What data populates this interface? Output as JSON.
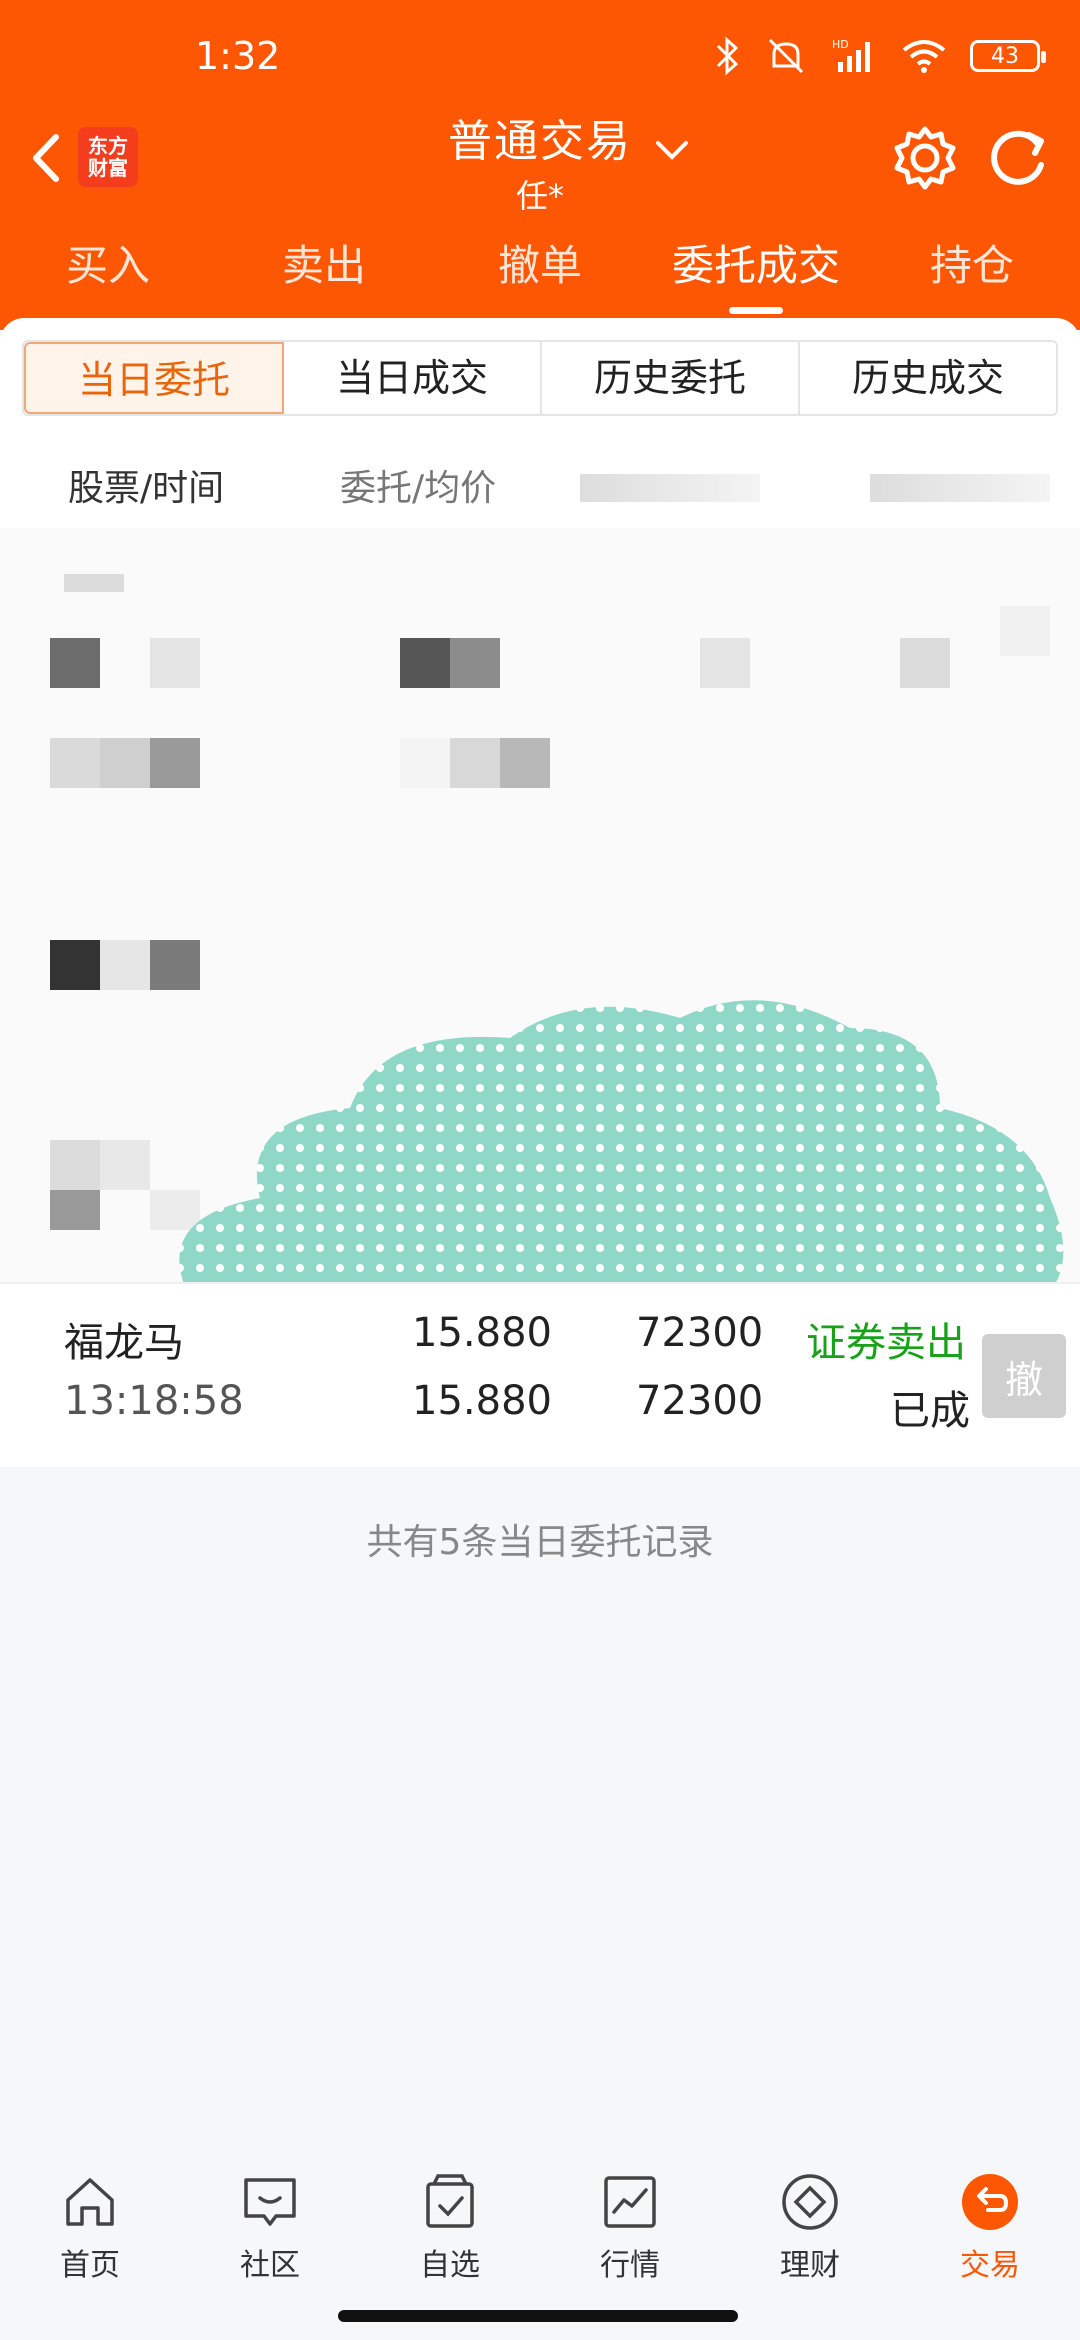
{
  "status_bar": {
    "time": "1:32",
    "battery": "43",
    "network": "HD"
  },
  "header": {
    "logo_text": "东方\n财富",
    "title": "普通交易",
    "subtitle": "任*",
    "tabs": [
      {
        "label": "买入",
        "active": false
      },
      {
        "label": "卖出",
        "active": false
      },
      {
        "label": "撤单",
        "active": false
      },
      {
        "label": "委托成交",
        "active": true
      },
      {
        "label": "持仓",
        "active": false
      }
    ]
  },
  "segment": {
    "items": [
      {
        "label": "当日委托",
        "active": true
      },
      {
        "label": "当日成交",
        "active": false
      },
      {
        "label": "历史委托",
        "active": false
      },
      {
        "label": "历史成交",
        "active": false
      }
    ]
  },
  "columns": {
    "stock_time": "股票/时间",
    "price": "委托/均价"
  },
  "order": {
    "name": "福龙马",
    "time": "13:18:58",
    "order_price": "15.880",
    "avg_price": "15.880",
    "order_qty": "72300",
    "filled_qty": "72300",
    "type": "证券卖出",
    "status": "已成",
    "cancel_label": "撤"
  },
  "summary": {
    "record_count": "共有5条当日委托记录"
  },
  "bottom_nav": {
    "items": [
      {
        "label": "首页",
        "icon": "home-icon",
        "active": false
      },
      {
        "label": "社区",
        "icon": "community-icon",
        "active": false
      },
      {
        "label": "自选",
        "icon": "watchlist-icon",
        "active": false
      },
      {
        "label": "行情",
        "icon": "market-icon",
        "active": false
      },
      {
        "label": "理财",
        "icon": "wealth-icon",
        "active": false
      },
      {
        "label": "交易",
        "icon": "trade-icon",
        "active": true
      }
    ]
  },
  "colors": {
    "brand": "#fe5703",
    "active_tab": "#e9650c",
    "sell_green": "#19a219"
  }
}
